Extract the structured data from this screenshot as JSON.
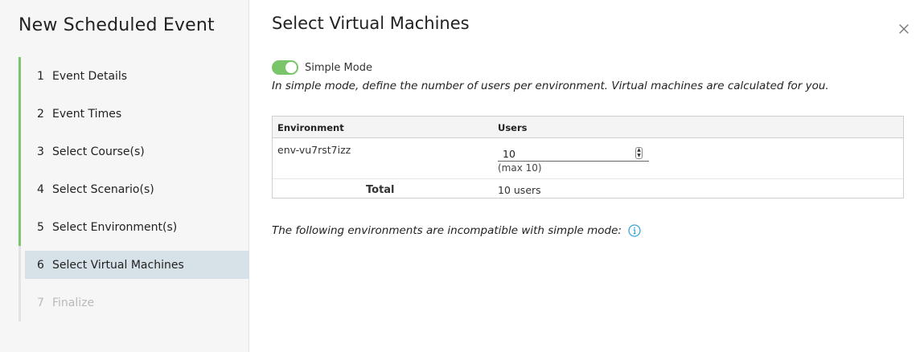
{
  "sidebar": {
    "title": "New Scheduled Event",
    "steps": [
      {
        "number": "1",
        "label": "Event Details"
      },
      {
        "number": "2",
        "label": "Event Times"
      },
      {
        "number": "3",
        "label": "Select Course(s)"
      },
      {
        "number": "4",
        "label": "Select Scenario(s)"
      },
      {
        "number": "5",
        "label": "Select Environment(s)"
      },
      {
        "number": "6",
        "label": "Select Virtual Machines"
      },
      {
        "number": "7",
        "label": "Finalize"
      }
    ]
  },
  "main": {
    "title": "Select Virtual Machines",
    "toggle": {
      "label": "Simple Mode",
      "on": true
    },
    "description": "In simple mode, define the number of users per environment. Virtual machines are calculated for you.",
    "table": {
      "headers": [
        "Environment",
        "Users"
      ],
      "rows": [
        {
          "environment": "env-vu7rst7izz",
          "users": "10",
          "max_note": "(max 10)"
        }
      ],
      "total_label": "Total",
      "total_value": "10 users"
    },
    "incompatible_text": "The following environments are incompatible with simple mode:"
  },
  "icons": {
    "close": "close-icon",
    "info": "info-icon"
  },
  "colors": {
    "accent": "#7ac46a",
    "active_step_bg": "#d7e1e8",
    "info": "#3aa6d6"
  }
}
